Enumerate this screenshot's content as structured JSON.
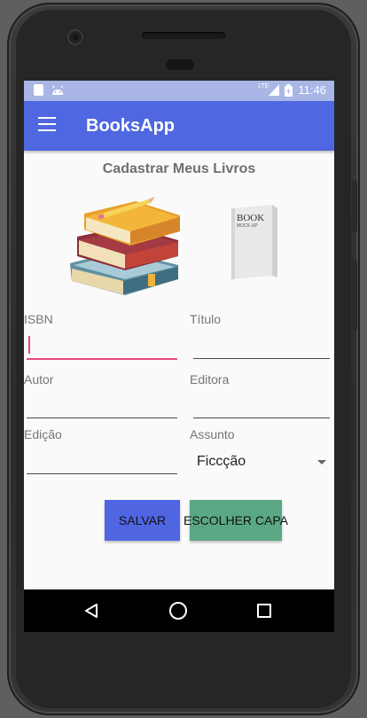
{
  "status": {
    "network": "LTE",
    "time": "11:46"
  },
  "appbar": {
    "title": "BooksApp"
  },
  "page": {
    "title": "Cadastrar Meus Livros"
  },
  "cover": {
    "text_line1": "BOOK",
    "text_line2": "MOCK-UP"
  },
  "form": {
    "isbn": {
      "label": "ISBN",
      "value": ""
    },
    "titulo": {
      "label": "Título",
      "value": ""
    },
    "autor": {
      "label": "Autor",
      "value": ""
    },
    "editora": {
      "label": "Editora",
      "value": ""
    },
    "edicao": {
      "label": "Edição",
      "value": ""
    },
    "assunto": {
      "label": "Assunto",
      "selected": "Ficcção"
    }
  },
  "buttons": {
    "save": "SALVAR",
    "choose_cover": "ESCOLHER CAPA"
  },
  "colors": {
    "appbar": "#4f67e0",
    "statusbar": "#a9b6e6",
    "focus_accent": "#e8477f",
    "save_button": "#5065e2",
    "cover_button": "#5aa884"
  }
}
